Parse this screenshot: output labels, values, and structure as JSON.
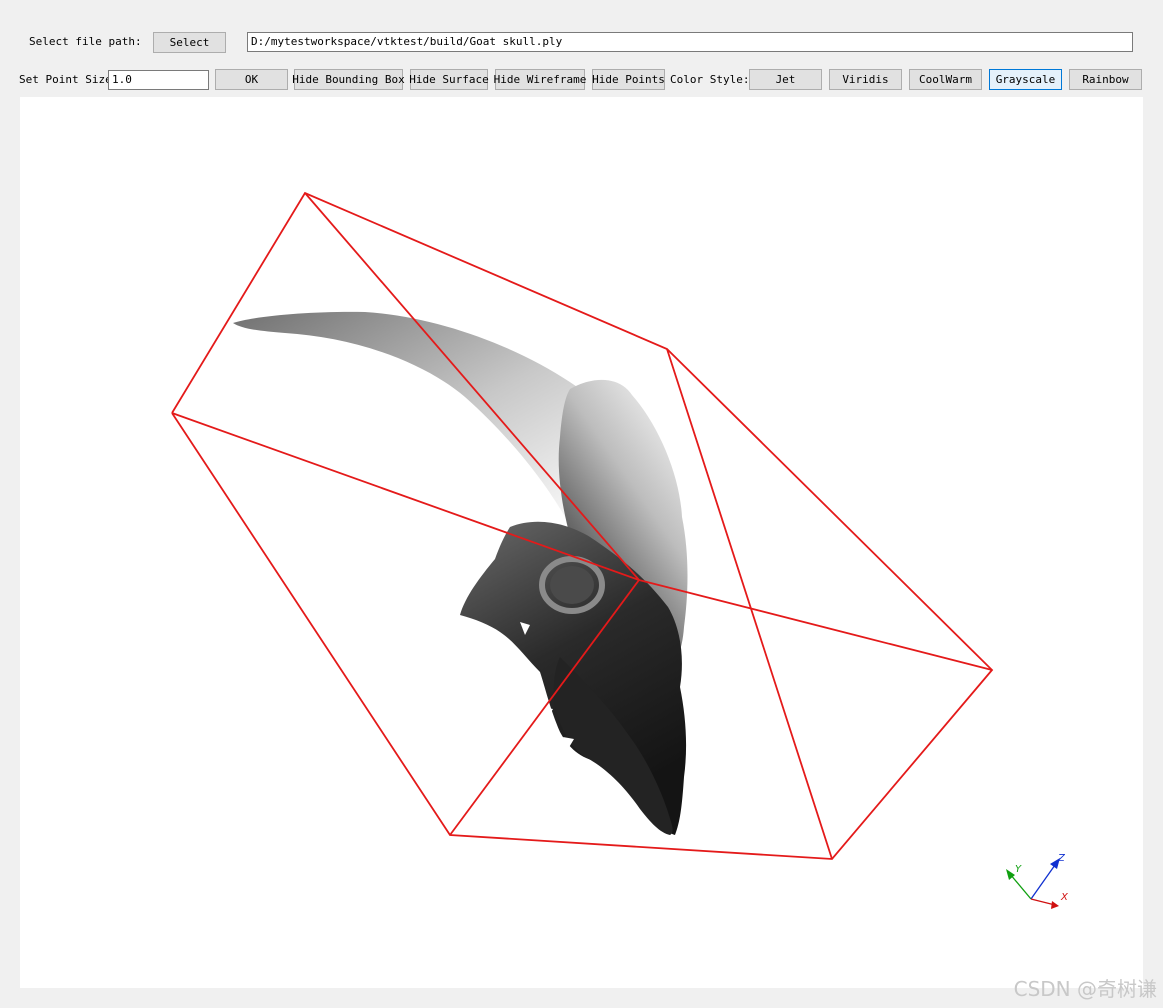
{
  "file_row": {
    "label": "Select file path:",
    "select_button": "Select",
    "path_value": "D:/mytestworkspace/vtktest/build/Goat skull.ply"
  },
  "toolbar": {
    "point_size_label": "Set Point Size",
    "point_size_value": "1.0",
    "ok_button": "OK",
    "hide_bbox_button": "Hide Bounding Box",
    "hide_surface_button": "Hide Surface",
    "hide_wireframe_button": "Hide Wireframe",
    "hide_points_button": "Hide Points",
    "color_style_label": "Color Style:",
    "color_buttons": [
      "Jet",
      "Viridis",
      "CoolWarm",
      "Grayscale",
      "Rainbow"
    ],
    "active_color_style": "Grayscale"
  },
  "viewport": {
    "bounding_box_color": "#e41a1a",
    "axes": {
      "x_label": "X",
      "y_label": "Y",
      "z_label": "Z",
      "x_color": "#d01010",
      "y_color": "#10a010",
      "z_color": "#1030d0"
    }
  },
  "watermark": "CSDN @奇树谦"
}
